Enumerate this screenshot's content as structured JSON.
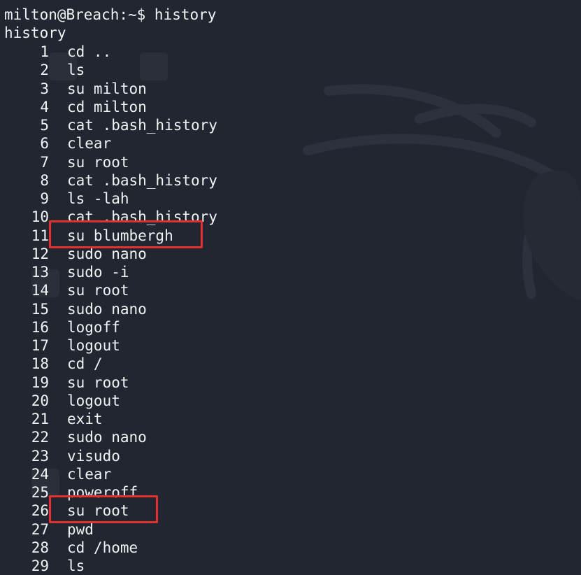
{
  "terminal": {
    "prompt": "milton@Breach:~$ history",
    "echo": "history",
    "entries": [
      {
        "num": "1",
        "cmd": "cd .."
      },
      {
        "num": "2",
        "cmd": "ls"
      },
      {
        "num": "3",
        "cmd": "su milton"
      },
      {
        "num": "4",
        "cmd": "cd milton"
      },
      {
        "num": "5",
        "cmd": "cat .bash_history"
      },
      {
        "num": "6",
        "cmd": "clear"
      },
      {
        "num": "7",
        "cmd": "su root"
      },
      {
        "num": "8",
        "cmd": "cat .bash_history"
      },
      {
        "num": "9",
        "cmd": "ls -lah"
      },
      {
        "num": "10",
        "cmd": "cat .bash_history"
      },
      {
        "num": "11",
        "cmd": "su blumbergh"
      },
      {
        "num": "12",
        "cmd": "sudo nano"
      },
      {
        "num": "13",
        "cmd": "sudo -i"
      },
      {
        "num": "14",
        "cmd": "su root"
      },
      {
        "num": "15",
        "cmd": "sudo nano"
      },
      {
        "num": "16",
        "cmd": "logoff"
      },
      {
        "num": "17",
        "cmd": "logout"
      },
      {
        "num": "18",
        "cmd": "cd /"
      },
      {
        "num": "19",
        "cmd": "su root"
      },
      {
        "num": "20",
        "cmd": "logout"
      },
      {
        "num": "21",
        "cmd": "exit"
      },
      {
        "num": "22",
        "cmd": "sudo nano"
      },
      {
        "num": "23",
        "cmd": "visudo"
      },
      {
        "num": "24",
        "cmd": "clear"
      },
      {
        "num": "25",
        "cmd": "poweroff"
      },
      {
        "num": "26",
        "cmd": "su root"
      },
      {
        "num": "27",
        "cmd": "pwd"
      },
      {
        "num": "28",
        "cmd": "cd /home"
      },
      {
        "num": "29",
        "cmd": "ls"
      }
    ]
  },
  "colors": {
    "background": "#222631",
    "text": "#f0f2f4",
    "highlight": "#e53030"
  },
  "highlighted_entries": [
    "11",
    "26"
  ]
}
